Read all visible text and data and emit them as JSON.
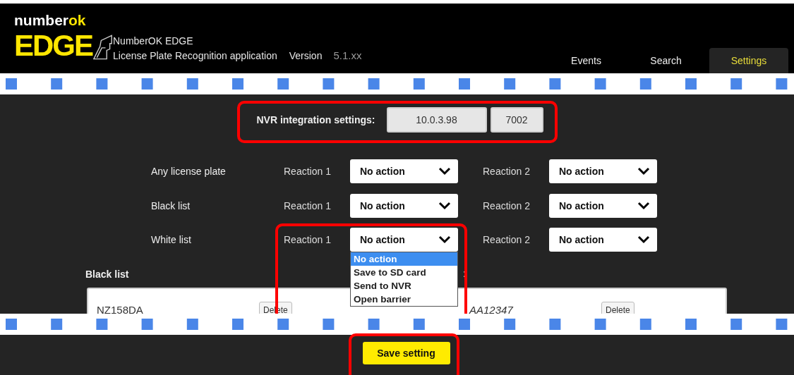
{
  "header": {
    "logo_top": "number",
    "logo_top_accent": "ok",
    "logo_main": "EDGE",
    "app_name": "NumberOK EDGE",
    "app_description": "License Plate Recognition application",
    "version_label": "Version",
    "version": "5.1.xx"
  },
  "tabs": [
    {
      "label": "Events",
      "selected": false
    },
    {
      "label": "Search",
      "selected": false
    },
    {
      "label": "Settings",
      "selected": true
    }
  ],
  "nvr": {
    "label": "NVR integration settings:",
    "ip": "10.0.3.98",
    "port": "7002",
    "highlighted": true
  },
  "rules": [
    {
      "name": "Any license plate",
      "reactions": [
        {
          "label": "Reaction 1",
          "value": "No action"
        },
        {
          "label": "Reaction 2",
          "value": "No action"
        }
      ]
    },
    {
      "name": "Black list",
      "reactions": [
        {
          "label": "Reaction 1",
          "value": "No action"
        },
        {
          "label": "Reaction 2",
          "value": "No action"
        }
      ]
    },
    {
      "name": "White list",
      "reactions": [
        {
          "label": "Reaction 1",
          "value": "No action",
          "highlighted": true,
          "options": [
            {
              "label": "No action",
              "selected": true
            },
            {
              "label": "Save to SD card",
              "selected": false
            },
            {
              "label": "Send to NVR",
              "selected": false
            },
            {
              "label": "Open barrier",
              "selected": false
            }
          ]
        },
        {
          "label": "Reaction 2",
          "value": "No action"
        }
      ]
    }
  ],
  "black_list": {
    "heading": "Black list",
    "heading_2_tail": ":",
    "entries": [
      {
        "plate": "NZ158DA",
        "action": "Delete"
      },
      {
        "plate": "AA12347",
        "action": "Delete"
      }
    ]
  },
  "save_button": {
    "label": "Save setting",
    "highlighted": true
  }
}
